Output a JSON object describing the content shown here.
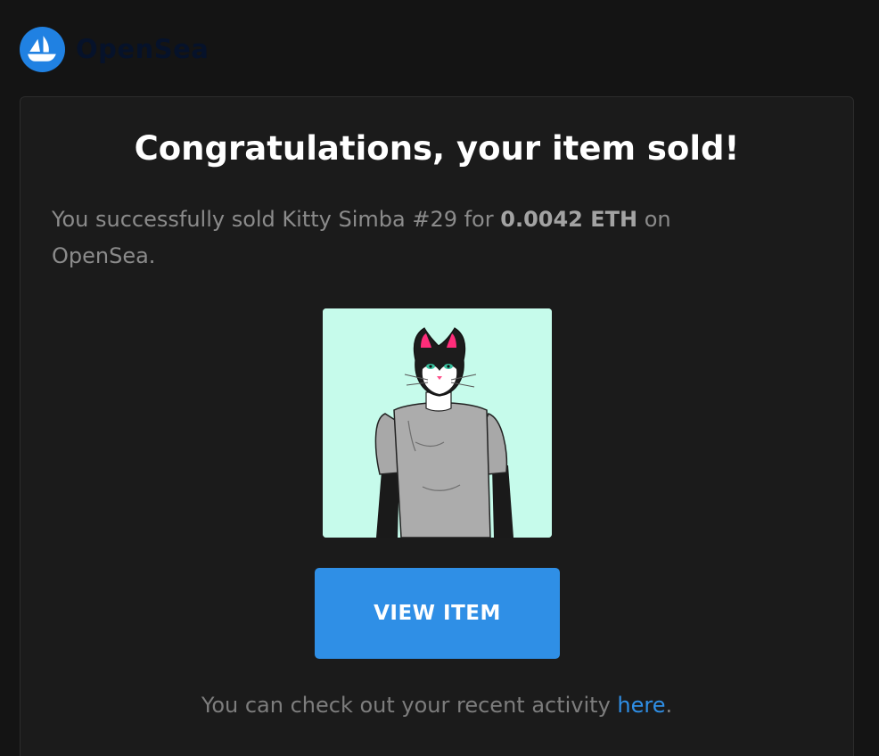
{
  "header": {
    "brand_name": "OpenSea",
    "logo_icon": "opensea-boat-icon",
    "logo_color": "#2081e2"
  },
  "email": {
    "title": "Congratulations, your item sold!",
    "message_prefix": "You successfully sold Kitty Simba #29 for ",
    "price": "0.0042 ETH",
    "message_suffix": " on OpenSea.",
    "item_image": {
      "icon": "cat-character-nft-image",
      "background": "#c6fbeb"
    },
    "button_label": "VIEW ITEM",
    "button_color": "#2f8fe6",
    "footer_prefix": "You can check out your recent activity ",
    "footer_link": "here",
    "footer_suffix": "."
  }
}
